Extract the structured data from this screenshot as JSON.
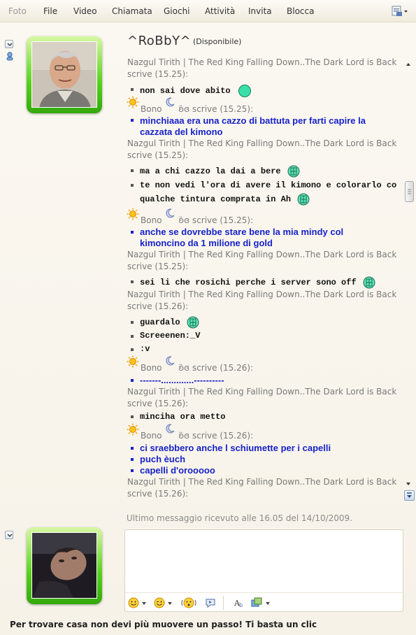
{
  "menu": {
    "items": [
      "Foto",
      "File",
      "Video",
      "Chiamata",
      "Giochi",
      "Attività",
      "Invita",
      "Blocca"
    ]
  },
  "contact": {
    "name": "^RoBbY^",
    "status": "(Disponibile)"
  },
  "conversation": [
    {
      "kind": "sender",
      "text": "Nazgul Tirith | The Red King Falling Down..The Dark Lord is Back.."
    },
    {
      "kind": "sender",
      "text": "scrive (15.25):"
    },
    {
      "kind": "msg",
      "text": "non sai dove abito",
      "color": "black"
    },
    {
      "kind": "sender2",
      "text": "Bono",
      "tail": "ʚ̈ɞ scrive (15.25):"
    },
    {
      "kind": "msg",
      "text": "minchiaaa era una cazzo di battuta per farti capire la",
      "color": "blue"
    },
    {
      "kind": "msg-cont",
      "text": "cazzata del kimono",
      "color": "blue"
    },
    {
      "kind": "sender",
      "text": "Nazgul Tirith | The Red King Falling Down..The Dark Lord is Back.."
    },
    {
      "kind": "sender",
      "text": "scrive (15.25):"
    },
    {
      "kind": "msg",
      "text": "ma a chi cazzo la dai a bere",
      "color": "black"
    },
    {
      "kind": "msg",
      "text": "te non vedi l'ora di avere il kimono e colorarlo con",
      "color": "black"
    },
    {
      "kind": "msg-cont",
      "text": "qualche tintura comprata in Ah",
      "color": "black"
    },
    {
      "kind": "sender2",
      "text": "Bono",
      "tail": "ʚ̈ɞ scrive (15.25):"
    },
    {
      "kind": "msg",
      "text": "anche se dovrebbe stare bene la mia mindy col",
      "color": "blue"
    },
    {
      "kind": "msg-cont",
      "text": "kimoncino da 1 milione di gold",
      "color": "blue"
    },
    {
      "kind": "sender",
      "text": "Nazgul Tirith | The Red King Falling Down..The Dark Lord is Back.."
    },
    {
      "kind": "sender",
      "text": "scrive (15.25):"
    },
    {
      "kind": "msg",
      "text": "sei li che rosichi perche i server sono off",
      "color": "black"
    },
    {
      "kind": "sender",
      "text": "Nazgul Tirith | The Red King Falling Down..The Dark Lord is Back.."
    },
    {
      "kind": "sender",
      "text": "scrive (15.26):"
    },
    {
      "kind": "msg",
      "text": "guardalo",
      "color": "black"
    },
    {
      "kind": "msg",
      "text": "Screeenen:_V",
      "color": "black"
    },
    {
      "kind": "msg",
      "text": ":v",
      "color": "black"
    },
    {
      "kind": "sender2",
      "text": "Bono",
      "tail": "ʚ̈ɞ scrive (15.26):"
    },
    {
      "kind": "msg",
      "text": "-------.............----------",
      "color": "blue"
    },
    {
      "kind": "sender",
      "text": "Nazgul Tirith | The Red King Falling Down..The Dark Lord is Back.."
    },
    {
      "kind": "sender",
      "text": "scrive (15.26):"
    },
    {
      "kind": "msg",
      "text": "minciha ora metto",
      "color": "black"
    },
    {
      "kind": "sender2",
      "text": "Bono",
      "tail": "ʚ̈ɞ scrive (15.26):"
    },
    {
      "kind": "msg",
      "text": "ci sraebbero anche l schiumette per i capelli",
      "color": "blue"
    },
    {
      "kind": "msg",
      "text": "puch èuch",
      "color": "blue"
    },
    {
      "kind": "msg",
      "text": "capelli d'orooooo",
      "color": "blue"
    },
    {
      "kind": "sender",
      "text": "Nazgul Tirith | The Red King Falling Down..The Dark Lord is Back.."
    },
    {
      "kind": "sender",
      "text": "scrive (15.26):"
    }
  ],
  "last_message": "Ultimo messaggio ricevuto alle 16.05 del 14/10/2009.",
  "ad": "Per trovare casa non devi più muovere un passo! Ti basta un clic",
  "icons": {
    "sun": "sun-icon",
    "moon": "moon-icon",
    "emoticon_round": "green-circle-emoticon",
    "emoticon_box": "box-emoticon"
  }
}
